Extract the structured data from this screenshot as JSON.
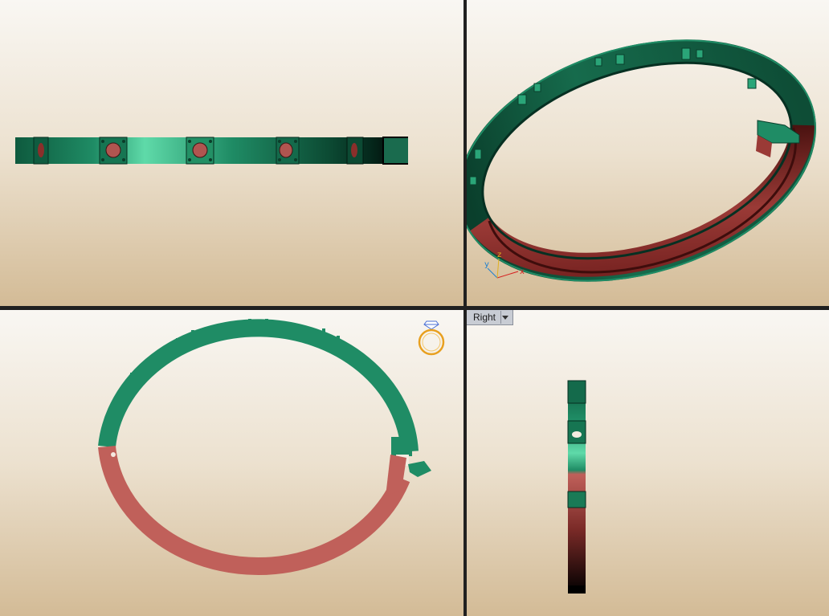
{
  "viewports": {
    "top_left": {
      "label": ""
    },
    "top_right": {
      "label": ""
    },
    "bottom_left": {
      "label": ""
    },
    "bottom_right": {
      "label": "Right"
    }
  },
  "axis_triad": {
    "x": "x",
    "y": "y",
    "z": "z"
  },
  "colors": {
    "ring_green": "#1f8c65",
    "ring_green_light": "#5fdaa9",
    "ring_red": "#c0605a",
    "ring_red_dark": "#7a1f1d",
    "divider": "#202020",
    "viewport_top": "#f9f7f3",
    "viewport_bottom": "#d3bb96",
    "ring_icon": "#e8a020",
    "gem_icon": "#4a6fd4"
  },
  "icons": {
    "ring_preview": "ring-with-gem-icon",
    "view_dropdown": "chevron-down-icon",
    "axis": "xyz-axis-icon"
  }
}
